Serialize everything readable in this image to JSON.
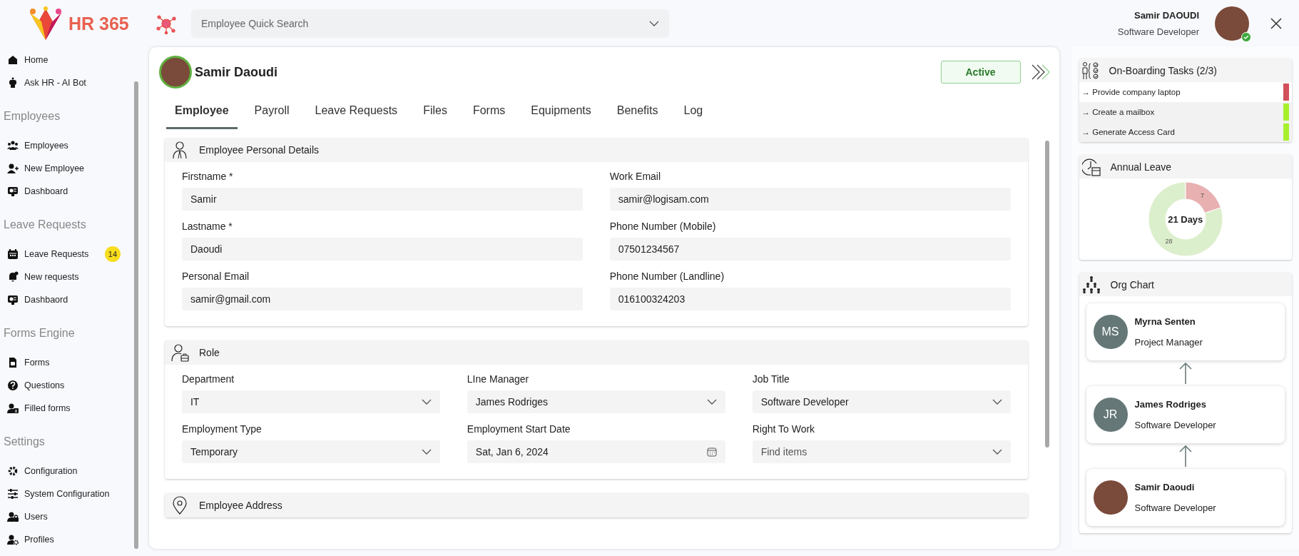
{
  "app": {
    "logo_text": "HR 365"
  },
  "search": {
    "placeholder": "Employee Quick Search"
  },
  "user": {
    "name": "Samir DAOUDI",
    "role": "Software Developer",
    "online": true
  },
  "sidebar": {
    "sections": [
      {
        "items": [
          {
            "label": "Home"
          },
          {
            "label": "Ask HR - AI Bot"
          }
        ]
      },
      {
        "title": "Employees",
        "items": [
          {
            "label": "Employees"
          },
          {
            "label": "New Employee"
          },
          {
            "label": "Dashboard"
          }
        ]
      },
      {
        "title": "Leave Requests",
        "items": [
          {
            "label": "Leave Requests",
            "badge": "14"
          },
          {
            "label": "New requests"
          },
          {
            "label": "Dashbaord"
          }
        ]
      },
      {
        "title": "Forms Engine",
        "items": [
          {
            "label": "Forms"
          },
          {
            "label": "Questions"
          },
          {
            "label": "Filled forms"
          }
        ]
      },
      {
        "title": "Settings",
        "items": [
          {
            "label": "Configuration"
          },
          {
            "label": "System Configuration"
          },
          {
            "label": "Users"
          },
          {
            "label": "Profiles"
          }
        ]
      }
    ]
  },
  "employee": {
    "name": "Samir Daoudi",
    "status": "Active",
    "tabs": [
      {
        "label": "Employee",
        "selected": true
      },
      {
        "label": "Payroll",
        "selected": false
      },
      {
        "label": "Leave Requests",
        "selected": false
      },
      {
        "label": "Files",
        "selected": false
      },
      {
        "label": "Forms",
        "selected": false
      },
      {
        "label": "Equipments",
        "selected": false
      },
      {
        "label": "Benefits",
        "selected": false
      },
      {
        "label": "Log",
        "selected": false
      }
    ],
    "sections": [
      {
        "title": "Employee Personal Details",
        "kind": "person",
        "fields": [
          {
            "label": "Firstname *",
            "value": "Samir",
            "kind": "text"
          },
          {
            "label": "Work Email",
            "value": "samir@logisam.com",
            "kind": "text"
          },
          {
            "label": "Lastname *",
            "value": "Daoudi",
            "kind": "text"
          },
          {
            "label": "Phone Number (Mobile)",
            "value": "07501234567",
            "kind": "text"
          },
          {
            "label": "Personal Email",
            "value": "samir@gmail.com",
            "kind": "text"
          },
          {
            "label": "Phone Number (Landline)",
            "value": "016100324203",
            "kind": "text"
          }
        ]
      },
      {
        "title": "Role",
        "kind": "role",
        "fields": [
          {
            "label": "Department",
            "value": "IT",
            "kind": "select"
          },
          {
            "label": "LIne Manager",
            "value": "James Rodriges",
            "kind": "select"
          },
          {
            "label": "Job Title",
            "value": "Software Developer",
            "kind": "select"
          },
          {
            "label": "Employment Type",
            "value": "Temporary",
            "kind": "select"
          },
          {
            "label": "Employment Start Date",
            "value": "Sat, Jan 6, 2024",
            "kind": "date"
          },
          {
            "label": "Right To Work",
            "placeholder": "Find items",
            "kind": "select"
          }
        ]
      },
      {
        "title": "Employee Address",
        "kind": "pin"
      }
    ]
  },
  "onboarding": {
    "title": "On-Boarding Tasks (2/3)",
    "tasks": [
      {
        "label": "→ Provide company laptop",
        "done": false
      },
      {
        "label": "→ Create a mailbox",
        "done": true
      },
      {
        "label": "→ Generate Access Card",
        "done": true
      }
    ]
  },
  "annual_leave": {
    "title": "Annual Leave",
    "center_text": "21 Days",
    "chart_data": {
      "type": "donut",
      "values": [
        7,
        28
      ],
      "data_labels": true
    }
  },
  "org_chart": {
    "title": "Org Chart",
    "nodes": [
      {
        "kind": "initials",
        "initials": "MS",
        "name": "Myrna Senten",
        "role": "Project Manager"
      },
      {
        "kind": "initials",
        "initials": "JR",
        "name": "James Rodriges",
        "role": "Software Developer"
      },
      {
        "kind": "photo",
        "name": "Samir Daoudi",
        "role": "Software Developer"
      }
    ]
  }
}
